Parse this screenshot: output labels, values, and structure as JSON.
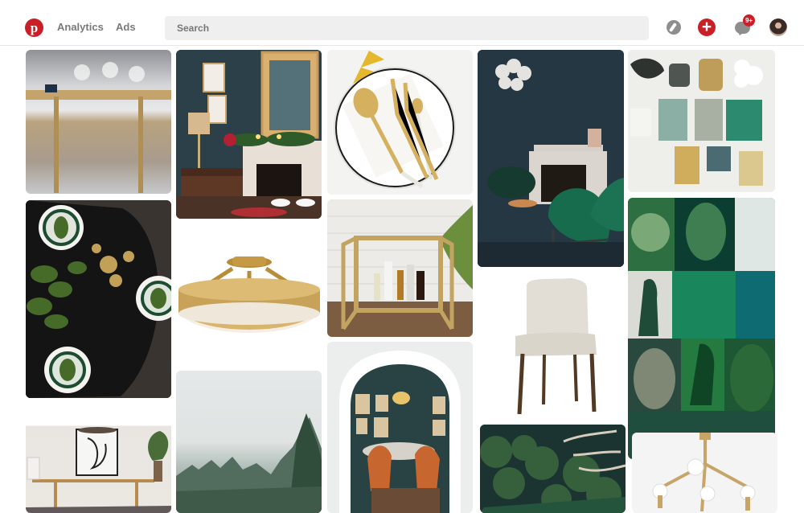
{
  "header": {
    "logo_letter": "p",
    "nav": [
      {
        "label": "Analytics"
      },
      {
        "label": "Ads"
      }
    ],
    "search": {
      "placeholder": "Search",
      "value": ""
    },
    "icons": [
      "pinterest-logo-icon",
      "compass-icon",
      "plus-icon",
      "chat-icon",
      "profile-avatar"
    ],
    "notifications_badge": "9+",
    "accent_color": "#cb1f27"
  },
  "pins": [
    {
      "name": "dining-table-glassware"
    },
    {
      "name": "navy-living-room-fireplace"
    },
    {
      "name": "gold-cutlery-plate"
    },
    {
      "name": "dark-room-green-velvet-chair"
    },
    {
      "name": "green-vases-collage"
    },
    {
      "name": "black-table-setting-leaves"
    },
    {
      "name": "brass-ceiling-light"
    },
    {
      "name": "gold-bar-cart"
    },
    {
      "name": "white-dining-chair"
    },
    {
      "name": "green-fashion-mood-board"
    },
    {
      "name": "brass-dining-console"
    },
    {
      "name": "misty-forest"
    },
    {
      "name": "arched-dining-room"
    },
    {
      "name": "dark-green-trees"
    },
    {
      "name": "brass-chandelier"
    }
  ],
  "palette": [
    "#9fc28e",
    "#7f8f76",
    "#45a567",
    "#159b63",
    "#186d4f",
    "#1e3e40",
    "#1c3050",
    "#171f3b"
  ]
}
